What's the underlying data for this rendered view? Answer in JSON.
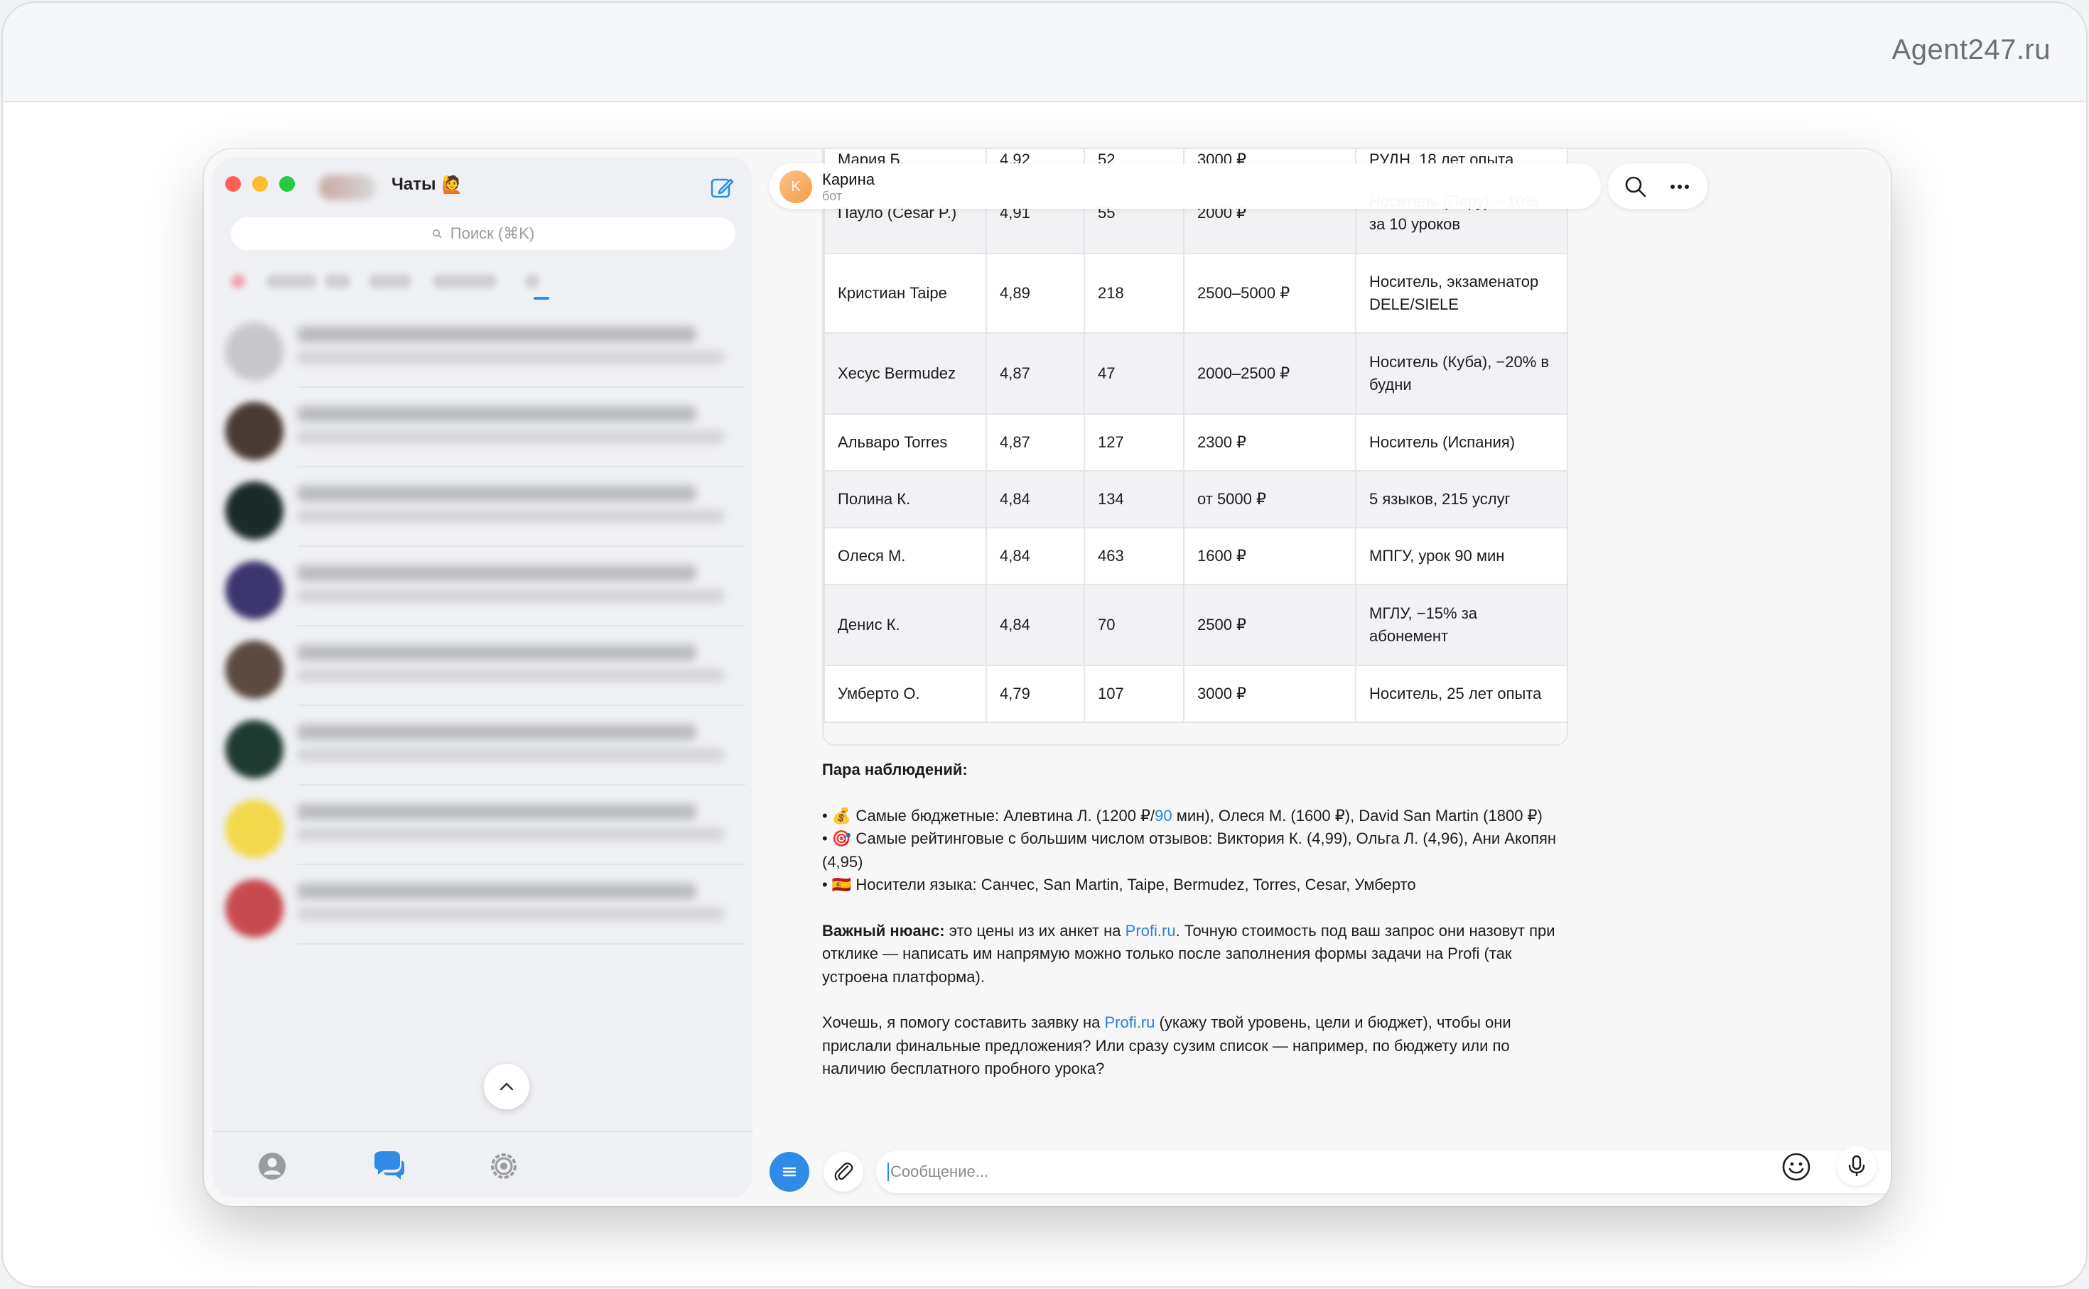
{
  "brand": "Agent247.ru",
  "sidebar": {
    "title": "Чаты",
    "title_emoji": "🙋",
    "search_placeholder": "Поиск (⌘K)"
  },
  "chat": {
    "name": "Карина",
    "subtitle": "бот",
    "avatar_letter": "K"
  },
  "table": {
    "partial_top_row": [
      "Мария Б.",
      "4,92",
      "52",
      "3000 ₽",
      "РУДН, 18 лет опыта"
    ],
    "rows": [
      [
        "Пауло (Cesar P.)",
        "4,91",
        "55",
        "2000 ₽",
        "Носитель (Перу), −10% за 10 уроков"
      ],
      [
        "Кристиан Taipe",
        "4,89",
        "218",
        "2500–5000 ₽",
        "Носитель, экзаменатор DELE/SIELE"
      ],
      [
        "Хесус Bermudez",
        "4,87",
        "47",
        "2000–2500 ₽",
        "Носитель (Куба), −20% в будни"
      ],
      [
        "Альваро Torres",
        "4,87",
        "127",
        "2300 ₽",
        "Носитель (Испания)"
      ],
      [
        "Полина К.",
        "4,84",
        "134",
        "от 5000 ₽",
        "5 языков, 215 услуг"
      ],
      [
        "Олеся М.",
        "4,84",
        "463",
        "1600 ₽",
        "МПГУ, урок 90 мин"
      ],
      [
        "Денис К.",
        "4,84",
        "70",
        "2500 ₽",
        "МГЛУ, −15% за абонемент"
      ],
      [
        "Умберто О.",
        "4,79",
        "107",
        "3000 ₽",
        "Носитель, 25 лет опыта"
      ]
    ]
  },
  "message": {
    "heading": "Пара наблюдений:",
    "b1_icon": "💰",
    "b1_pre": "Самые бюджетные: Алевтина Л. (1200 ₽/",
    "b1_link": "90",
    "b1_post": " мин), Олеся М. (1600 ₽), David San Martin (1800 ₽)",
    "b2_icon": "🎯",
    "b2": "Самые рейтинговые с большим числом отзывов: Виктория К. (4,99), Ольга Л. (4,96), Ани Акопян (4,95)",
    "b3_icon": "🇪🇸",
    "b3": "Носители языка: Санчес, San Martin, Taipe, Bermudez, Torres, Cesar, Умберто",
    "nuance_label": "Важный нюанс:",
    "nuance_pre": " это цены из их анкет на ",
    "nuance_link": "Profi.ru",
    "nuance_post": ". Точную стоимость под ваш запрос они назовут при отклике — написать им напрямую можно только после заполнения формы задачи на Profi (так устроена платформа).",
    "final_pre": "Хочешь, я помогу составить заявку на ",
    "final_link": "Profi.ru",
    "final_post": " (укажу твой уровень, цели и бюджет), чтобы они прислали финальные предложения? Или сразу сузим список — например, по бюджету или по наличию бесплатного пробного урока?"
  },
  "composer": {
    "placeholder": "Сообщение..."
  },
  "colors": {
    "accent": "#2f8be6",
    "link": "#2b7fd4"
  }
}
